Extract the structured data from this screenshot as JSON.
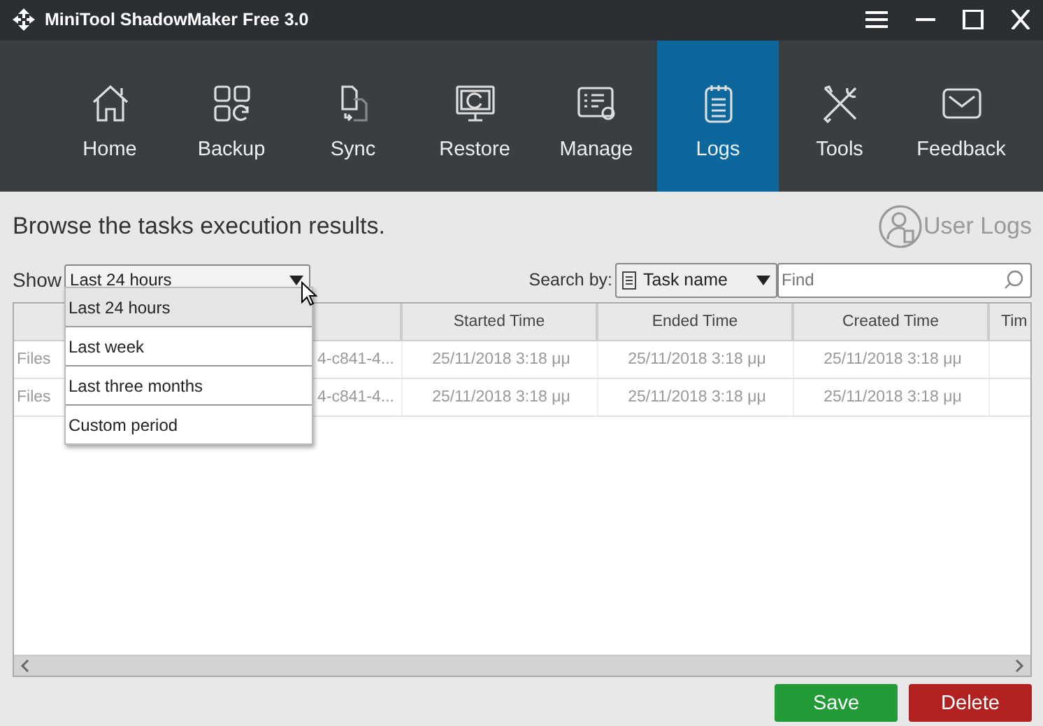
{
  "window": {
    "title": "MiniTool ShadowMaker Free 3.0"
  },
  "nav": [
    {
      "label": "Home",
      "kind": "home",
      "selected": false
    },
    {
      "label": "Backup",
      "kind": "backup",
      "selected": false
    },
    {
      "label": "Sync",
      "kind": "sync",
      "selected": false
    },
    {
      "label": "Restore",
      "kind": "restore",
      "selected": false
    },
    {
      "label": "Manage",
      "kind": "manage",
      "selected": false
    },
    {
      "label": "Logs",
      "kind": "logs",
      "selected": true
    },
    {
      "label": "Tools",
      "kind": "tools",
      "selected": false
    },
    {
      "label": "Feedback",
      "kind": "feedback",
      "selected": false
    }
  ],
  "heading": "Browse the tasks execution results.",
  "user_logs": "User Logs",
  "show": {
    "label": "Show",
    "value": "Last 24 hours",
    "options": [
      {
        "label": "Last 24 hours",
        "selected": true
      },
      {
        "label": "Last week",
        "selected": false
      },
      {
        "label": "Last three months",
        "selected": false
      },
      {
        "label": "Custom period",
        "selected": false
      }
    ]
  },
  "search": {
    "label": "Search by:",
    "field": "Task name",
    "placeholder": "Find"
  },
  "table": {
    "columns": [
      "Started Time",
      "Ended Time",
      "Created Time",
      "Tim"
    ],
    "rows": [
      {
        "name": "Files",
        "id": "4-c841-4...",
        "started": "25/11/2018 3:18 μμ",
        "ended": "25/11/2018 3:18 μμ",
        "created": "25/11/2018 3:18 μμ"
      },
      {
        "name": "Files",
        "id": "4-c841-4...",
        "started": "25/11/2018 3:18 μμ",
        "ended": "25/11/2018 3:18 μμ",
        "created": "25/11/2018 3:18 μμ"
      }
    ]
  },
  "buttons": [
    {
      "label": "Save",
      "kind": "save"
    },
    {
      "label": "Delete",
      "kind": "delete"
    }
  ]
}
